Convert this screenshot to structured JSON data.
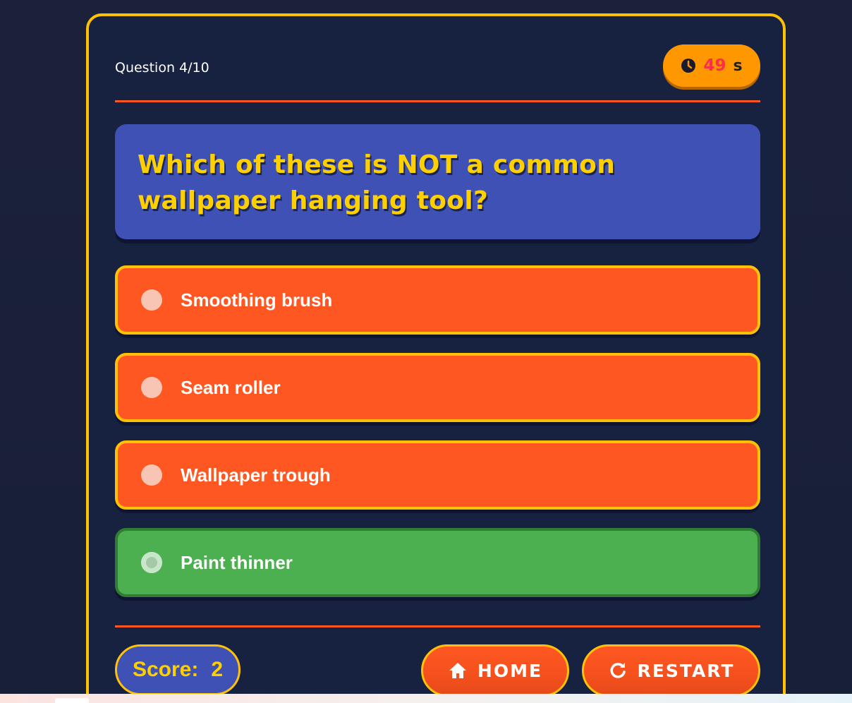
{
  "header": {
    "question_count": "Question 4/10",
    "timer_value": "49",
    "timer_unit": "s",
    "timer_icon": "clock-icon"
  },
  "question": {
    "text": "Which of these is NOT a common wallpaper hanging tool?"
  },
  "options": [
    {
      "label": "Smoothing brush",
      "state": "default"
    },
    {
      "label": "Seam roller",
      "state": "default"
    },
    {
      "label": "Wallpaper trough",
      "state": "default"
    },
    {
      "label": "Paint thinner",
      "state": "correct"
    }
  ],
  "footer": {
    "score_label": "Score:",
    "score_value": "2",
    "home_label": "HOME",
    "home_icon": "home-icon",
    "restart_label": "RESTART",
    "restart_icon": "restart-icon"
  },
  "colors": {
    "background": "#182038",
    "card_border": "#ffc107",
    "accent_orange": "#ff5722",
    "question_bg": "#3f51b5",
    "question_text": "#ffd000",
    "correct_green": "#4caf50",
    "timer_bg": "#ff9800"
  }
}
